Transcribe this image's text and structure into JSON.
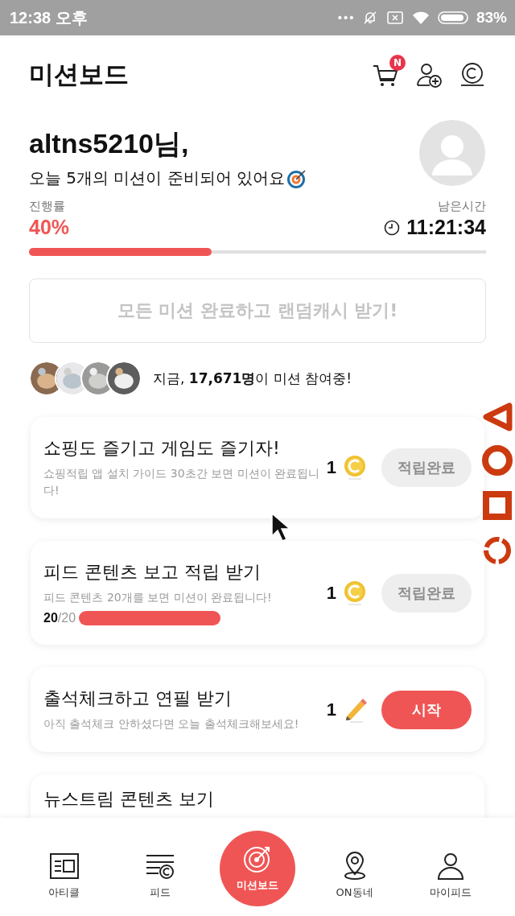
{
  "status_bar": {
    "time": "12:38 오후",
    "dots": "•••",
    "battery": "83%"
  },
  "header": {
    "title": "미션보드",
    "cart_badge": "N"
  },
  "greeting": {
    "name": "altns5210님,",
    "message": "오늘 5개의 미션이 준비되어 있어요"
  },
  "progress": {
    "label": "진행률",
    "value": "40%",
    "level": 0.4,
    "time_label": "남은시간",
    "time": "11:21:34"
  },
  "bonus_button": {
    "label": "모든 미션 완료하고 랜덤캐시 받기!",
    "disabled": true
  },
  "participants": {
    "text": "지금, **17,671명**이 미션 참여중!"
  },
  "missions": [
    {
      "title": "쇼핑도 즐기고 게임도 즐기자!",
      "description": "쇼핑적립 앱 설치 가이드 30초간 보면 미션이 완료됩니다!",
      "reward": "1",
      "kind": "coin",
      "button": "적립완료",
      "completed": true
    },
    {
      "title": "피드 콘텐츠 보고 적립 받기",
      "description": "피드 콘텐츠 20개를 보면 미션이 완료됩니다!",
      "reward": "1",
      "kind": "coin",
      "button": "적립완료",
      "completed": true,
      "count": "20",
      "total": "/20"
    },
    {
      "title": "출석체크하고 연필 받기",
      "description": "아직 출석체크 안하셨다면 오늘 출석체크해보세요!",
      "reward": "1",
      "kind": "pencil",
      "button": "시작",
      "completed": false
    },
    {
      "title": "뉴스트림 콘텐츠 보기"
    }
  ],
  "bottom_nav": [
    {
      "label": "아티클",
      "selected": false
    },
    {
      "label": "피드",
      "selected": false
    },
    {
      "label": "미션보드",
      "selected": true
    },
    {
      "label": "ON동네",
      "selected": false
    },
    {
      "label": "마이피드",
      "selected": false
    }
  ]
}
